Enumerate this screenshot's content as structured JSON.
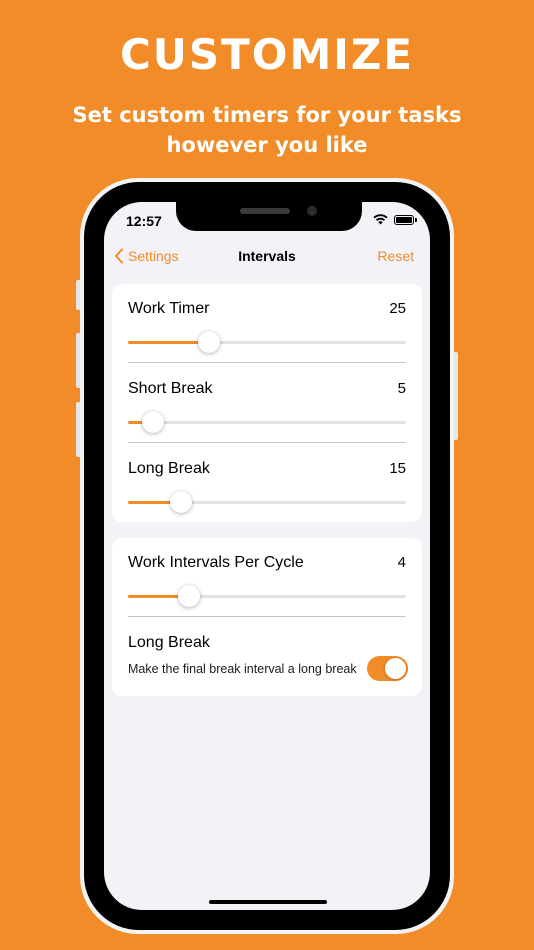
{
  "promo": {
    "headline": "CUSTOMIZE",
    "subhead_line1": "Set custom timers for your tasks",
    "subhead_line2": "however you like"
  },
  "status_bar": {
    "time": "12:57",
    "icons": [
      "wifi-icon",
      "battery-icon"
    ]
  },
  "nav": {
    "back_label": "Settings",
    "title": "Intervals",
    "reset_label": "Reset"
  },
  "timers": [
    {
      "label": "Work Timer",
      "value": "25",
      "fraction": 0.29
    },
    {
      "label": "Short Break",
      "value": "5",
      "fraction": 0.09
    },
    {
      "label": "Long Break",
      "value": "15",
      "fraction": 0.19
    }
  ],
  "cycle": {
    "label": "Work Intervals Per Cycle",
    "value": "4",
    "fraction": 0.22
  },
  "long_break_toggle": {
    "label": "Long Break",
    "description": "Make the final break interval a long break",
    "on": true
  },
  "colors": {
    "accent": "#F28C28",
    "background": "#F2F2F7",
    "card": "#FFFFFF"
  }
}
